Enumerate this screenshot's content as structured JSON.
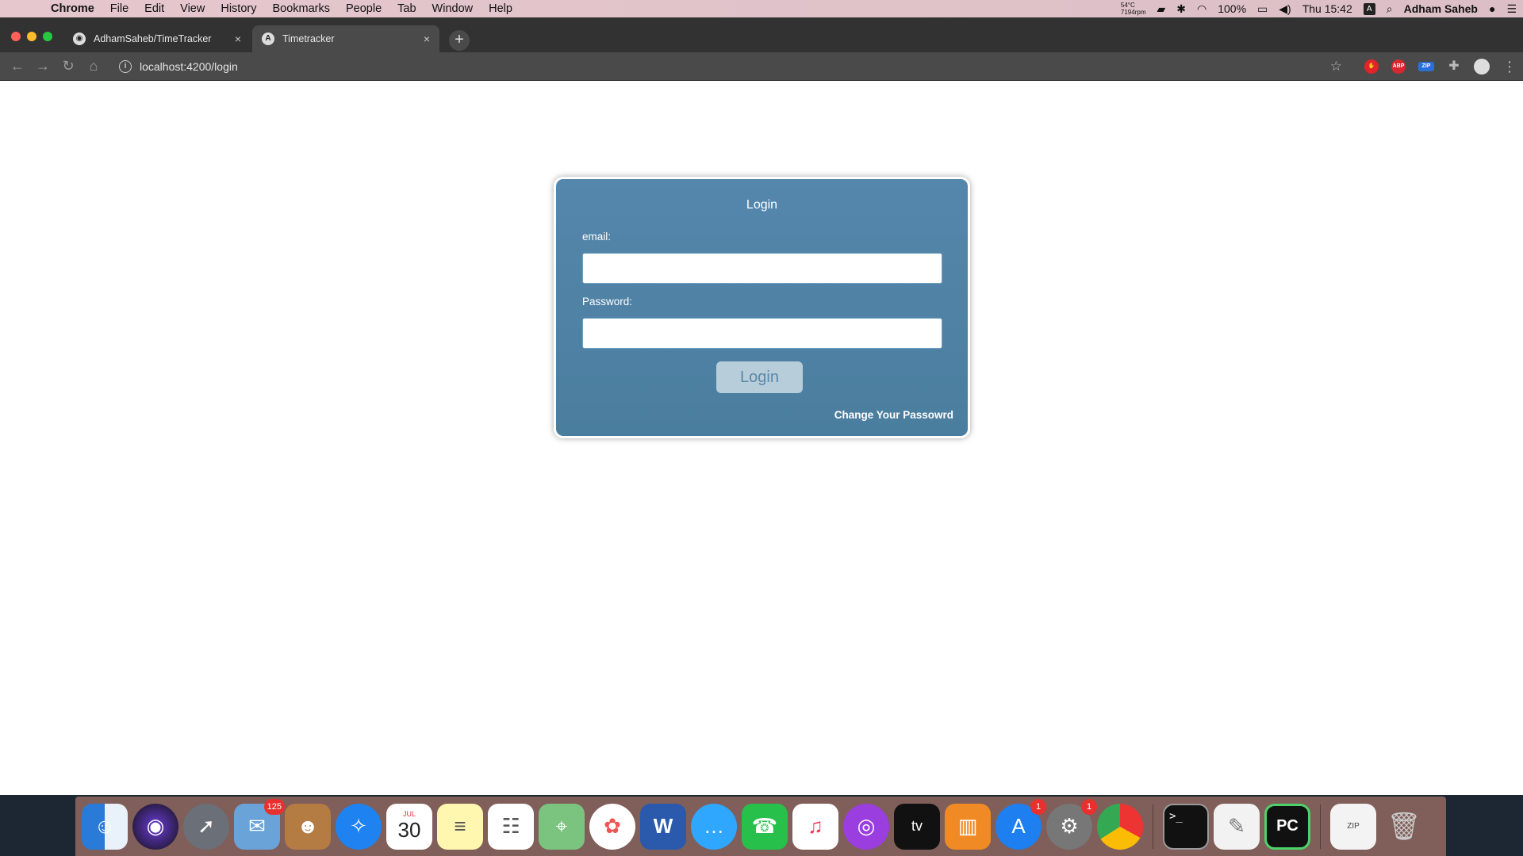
{
  "menubar": {
    "app_name": "Chrome",
    "items": [
      "File",
      "Edit",
      "View",
      "History",
      "Bookmarks",
      "People",
      "Tab",
      "Window",
      "Help"
    ],
    "temp_line1": "54°C",
    "temp_line2": "7194rpm",
    "battery": "100%",
    "clock": "Thu 15:42",
    "input_source": "A",
    "user": "Adham Saheb"
  },
  "tabs": [
    {
      "title": "AdhamSaheb/TimeTracker",
      "close": "×",
      "favicon": "github-icon"
    },
    {
      "title": "Timetracker",
      "close": "×",
      "favicon": "angular-icon"
    }
  ],
  "newtab_label": "+",
  "address": {
    "url": "localhost:4200/login"
  },
  "extensions": {
    "abp": "ABP",
    "zip": "ZIP"
  },
  "login": {
    "title": "Login",
    "email_label": "email:",
    "email_value": "",
    "password_label": "Password:",
    "password_value": "",
    "button": "Login",
    "change_password_link": "Change Your Passowrd"
  },
  "dock": {
    "mail_badge": "125",
    "calendar_month": "JUL",
    "calendar_day": "30",
    "appstore_badge": "1",
    "prefs_badge": "1",
    "word_letter": "W",
    "tv_label": "tv",
    "pycharm_label": "PC",
    "archive_label": "ZIP"
  }
}
